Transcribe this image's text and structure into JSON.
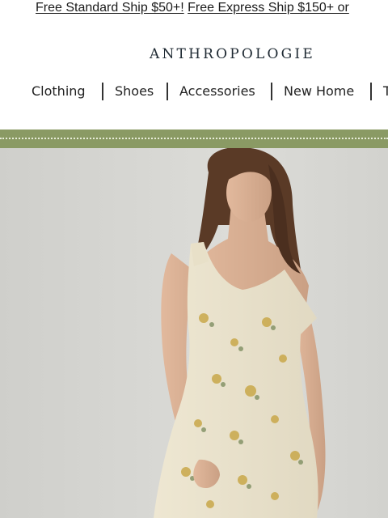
{
  "promo": {
    "standard": "Free Standard Ship $50+!",
    "express": "Free Express Ship $150+ or"
  },
  "brand": {
    "logo": "ANTHROPOLOGIE"
  },
  "nav": {
    "items": [
      "Clothing",
      "Shoes",
      "Accessories",
      "New Home",
      "T"
    ]
  },
  "colors": {
    "banner": "#8a9a64",
    "hero_bg": "#d4d4d0",
    "text": "#1a1a1a"
  },
  "hero": {
    "icon": "model-in-floral-dress-photo"
  }
}
